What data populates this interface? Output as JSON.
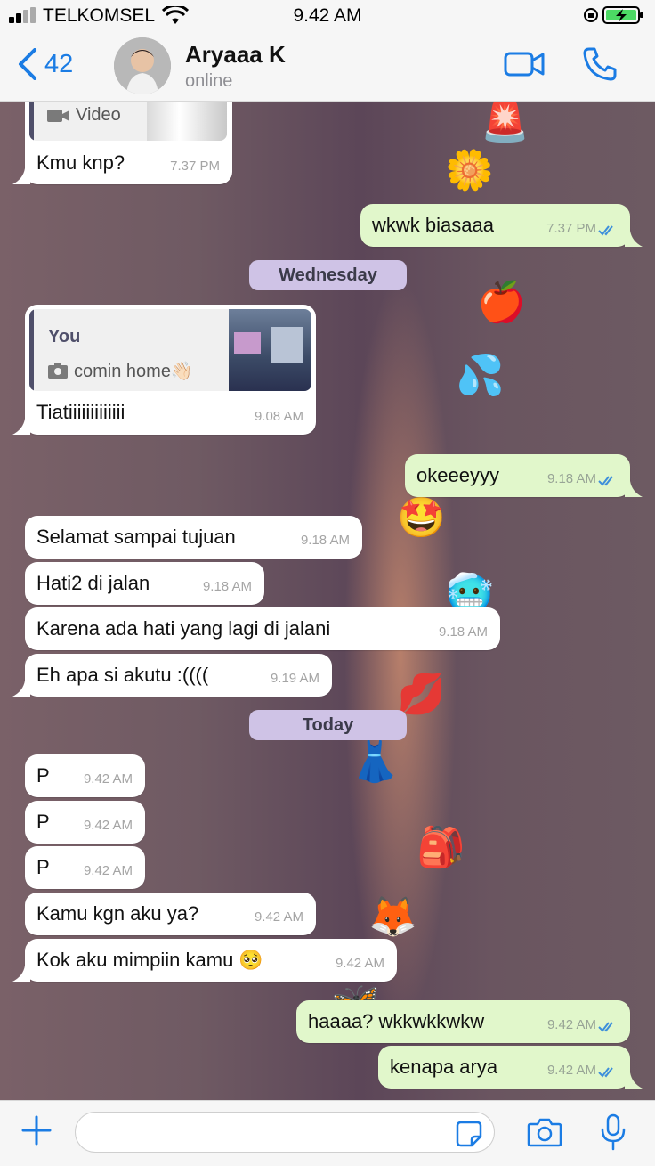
{
  "status_bar": {
    "carrier": "TELKOMSEL",
    "time": "9.42 AM"
  },
  "header": {
    "back_count": "42",
    "name": "Aryaaa K",
    "status": "online"
  },
  "colors": {
    "accent": "#1b7ce4",
    "outgoing_bubble": "#e1f7cb",
    "incoming_bubble": "#ffffff",
    "date_chip": "#cfc3e6",
    "read_ticks": "#3d8fdb"
  },
  "messages": [
    {
      "media_label": "Video",
      "text": "Kmu knp?",
      "time": "7.37 PM"
    },
    {
      "text": "wkwk biasaaa",
      "time": "7.37 PM"
    },
    {
      "quote_author": "You",
      "quote_text": "comin home👋🏻",
      "text": "Tiatiiiiiiiiiiiii",
      "time": "9.08 AM"
    },
    {
      "text": "okeeeyyy",
      "time": "9.18 AM"
    },
    {
      "text": "Selamat sampai tujuan",
      "time": "9.18 AM"
    },
    {
      "text": "Hati2 di jalan",
      "time": "9.18 AM"
    },
    {
      "text": "Karena ada hati yang lagi di jalani",
      "time": "9.18 AM"
    },
    {
      "text": "Eh apa si akutu :((((",
      "time": "9.19 AM"
    },
    {
      "text": "P",
      "time": "9.42 AM"
    },
    {
      "text": "P",
      "time": "9.42 AM"
    },
    {
      "text": "P",
      "time": "9.42 AM"
    },
    {
      "text": "Kamu kgn aku ya?",
      "time": "9.42 AM"
    },
    {
      "text": "Kok aku mimpiin kamu 🥺",
      "time": "9.42 AM"
    },
    {
      "text": "haaaa? wkkwkkwkw",
      "time": "9.42 AM"
    },
    {
      "text": "kenapa arya",
      "time": "9.42 AM"
    }
  ],
  "day_separators": [
    "Wednesday",
    "Today"
  ],
  "wallpaper_emojis": [
    "🚨",
    "🌼",
    "🍎",
    "💦",
    "🤩",
    "🥶",
    "💋",
    "👗",
    "🎒",
    "🦊",
    "🦋"
  ],
  "composer": {
    "placeholder": ""
  }
}
